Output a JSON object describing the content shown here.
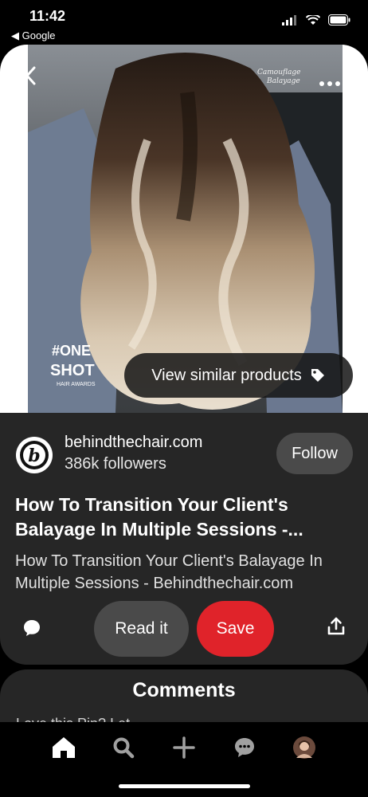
{
  "status": {
    "time": "11:42",
    "back_app": "◀ Google"
  },
  "hero": {
    "overlay_text": "Camouflage Balayage",
    "badge_line1": "#ONE",
    "badge_line2": "SHOT",
    "badge_line3": "HAIR AWARDS",
    "similar_label": "View similar products"
  },
  "source": {
    "avatar_letter": "b",
    "name": "behindthechair.com",
    "followers": "386k followers",
    "follow_label": "Follow"
  },
  "pin": {
    "title": "How To Transition Your Client's Balayage In Multiple Sessions -...",
    "description": "How To Transition Your Client's Balayage In Multiple Sessions - Behindthechair.com"
  },
  "actions": {
    "read_label": "Read it",
    "save_label": "Save"
  },
  "comments": {
    "title": "Comments",
    "preview": "Love this Pin? Let..."
  },
  "colors": {
    "save": "#e0232a",
    "card": "#262626",
    "button": "#4a4a4a"
  }
}
